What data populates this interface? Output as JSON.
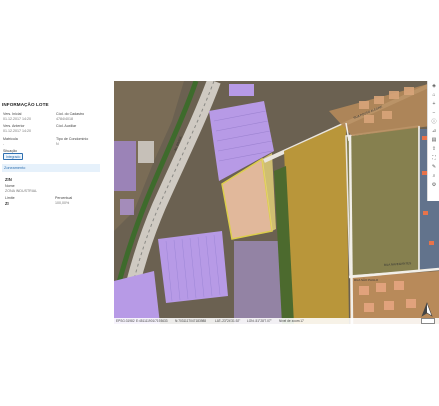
{
  "panel": {
    "title": "INFORMAÇÃO LOTE",
    "fields": [
      {
        "label": "Vers. Inicial",
        "value": "01.12.2017 14:20"
      },
      {
        "label": "Cód. do Cadastro",
        "value": "4784/4018"
      },
      {
        "label": "Vers. Anterior",
        "value": "01.12.2017 14:20"
      },
      {
        "label": "Cód. Auxiliar",
        "value": "-"
      },
      {
        "label": "Matrícula",
        "value": "-"
      },
      {
        "label": "Tipo de Condomínio",
        "value": "N"
      },
      {
        "label": "Situação",
        "value": "Integrado"
      }
    ],
    "zoning": {
      "section_label": "Zoneamento",
      "code": "ZIN",
      "name_label": "Nome",
      "name_value": "ZONA INDUSTRIAL",
      "limit_label": "Limite",
      "limit_value": "ZI",
      "percent_label": "Percentual",
      "percent_value": "100,00%"
    }
  },
  "map": {
    "toolbar_icons": [
      "layers-icon",
      "home-icon",
      "zoom-in-icon",
      "zoom-out-icon",
      "info-icon",
      "measure-icon",
      "print-icon",
      "share-icon",
      "fullscreen-icon",
      "draw-icon",
      "search-icon",
      "settings-icon"
    ],
    "status": {
      "epsg": "EPSG:31982",
      "coord1": "E:451111901/7193633",
      "coord2": "N:7031117047183988",
      "lat": "LAT:-23°24'31.92\"",
      "lon": "LON:-51°28'7.07\"",
      "zoom": "Nível de zoom:17"
    },
    "street_labels": [
      "RUA NAVEGANTES",
      "RUA POUSO ALEGRE",
      "RUA SÃO PAULO",
      "AV. BRASIL"
    ],
    "colors": {
      "highlight": "#f0e24a",
      "selected_fill": "#f6c8a8",
      "zone_overlay": "#b79ae6"
    }
  }
}
